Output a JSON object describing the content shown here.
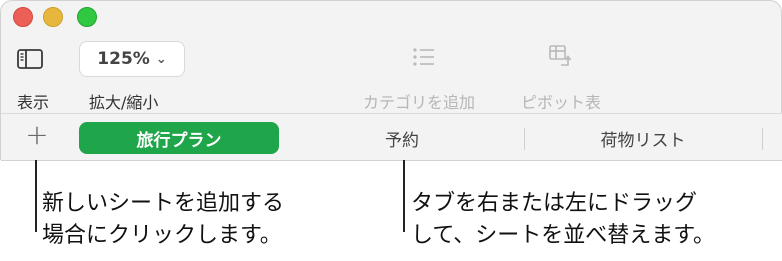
{
  "toolbar": {
    "view_label": "表示",
    "zoom_value": "125%",
    "zoom_label": "拡大/縮小",
    "category_label": "カテゴリを追加",
    "pivot_label": "ピボット表"
  },
  "tabs": {
    "add_symbol": "+",
    "items": [
      {
        "label": "旅行プラン",
        "active": true
      },
      {
        "label": "予約",
        "active": false
      },
      {
        "label": "荷物リスト",
        "active": false
      }
    ]
  },
  "callouts": {
    "left": [
      "新しいシートを追加する",
      "場合にクリックします。"
    ],
    "right": [
      "タブを右または左にドラッグ",
      "して、シートを並べ替えます。"
    ]
  },
  "colors": {
    "active_tab": "#1fa64a",
    "close": "#ec5f57",
    "minimize": "#e6b73c",
    "maximize": "#2fc840"
  }
}
